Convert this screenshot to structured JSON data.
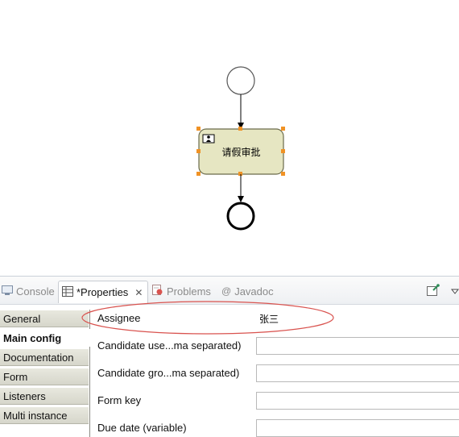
{
  "diagram": {
    "user_task_name": "请假审批",
    "colors": {
      "task_fill": "#e6e6c2",
      "task_border": "#6b6b4b",
      "handle": "#f09225",
      "flow": "#000000"
    }
  },
  "properties_view": {
    "tabs": [
      {
        "label": "Console",
        "icon": "console-icon",
        "active": false
      },
      {
        "label": "*Properties",
        "icon": "properties-icon",
        "active": true
      },
      {
        "label": "Problems",
        "icon": "problems-icon",
        "active": false
      },
      {
        "label": "Javadoc",
        "icon": "javadoc-icon",
        "active": false
      }
    ],
    "sections": [
      "General",
      "Main config",
      "Documentation",
      "Form",
      "Listeners",
      "Multi instance"
    ],
    "active_section": "Main config",
    "fields": [
      {
        "label": "Assignee",
        "value": "张三"
      },
      {
        "label": "Candidate use...ma separated)",
        "value": ""
      },
      {
        "label": "Candidate gro...ma separated)",
        "value": ""
      },
      {
        "label": "Form key",
        "value": ""
      },
      {
        "label": "Due date (variable)",
        "value": ""
      }
    ],
    "annotation_color": "#d9534f"
  }
}
